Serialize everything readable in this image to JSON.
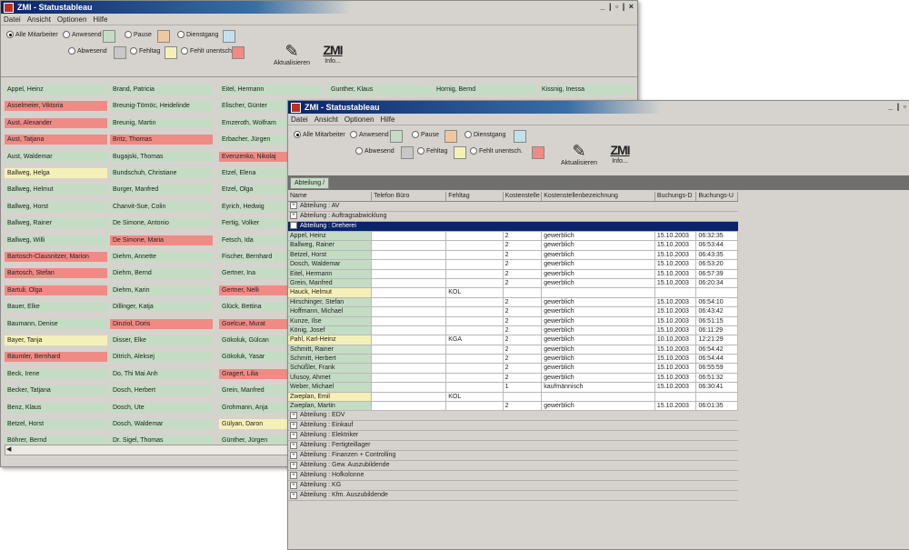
{
  "window1": {
    "title": "ZMI - Statustableau",
    "controls": "_ | ▫ | ×",
    "menu": [
      "Datei",
      "Ansicht",
      "Optionen",
      "Hilfe"
    ],
    "filters": {
      "all": "Alle Mitarbeiter",
      "present": "Anwesend",
      "pause": "Pause",
      "business_trip": "Dienstgang",
      "absent": "Abwesend",
      "absence_day": "Fehltag",
      "unexcused": "Fehlt unentsch."
    },
    "refresh_label": "Aktualisieren",
    "info_label": "Info...",
    "logo_text": "ZMI",
    "columns": [
      [
        {
          "name": "Appel, Heinz",
          "status": "green"
        },
        {
          "name": "Asselmeier, Viktoria",
          "status": "red"
        },
        {
          "name": "Aust, Alexander",
          "status": "red"
        },
        {
          "name": "Aust, Tatjana",
          "status": "red"
        },
        {
          "name": "Aust, Waldemar",
          "status": "green"
        },
        {
          "name": "Ballweg, Helga",
          "status": "yellow"
        },
        {
          "name": "Ballweg, Helmut",
          "status": "green"
        },
        {
          "name": "Ballweg, Horst",
          "status": "green"
        },
        {
          "name": "Ballweg, Rainer",
          "status": "green"
        },
        {
          "name": "Ballweg, Willi",
          "status": "green"
        },
        {
          "name": "Bartosch-Clausnitzer, Marion",
          "status": "red"
        },
        {
          "name": "Bartosch, Stefan",
          "status": "red"
        },
        {
          "name": "Bartuli, Olga",
          "status": "red"
        },
        {
          "name": "Bauer, Elke",
          "status": "green"
        },
        {
          "name": "Baumann, Denise",
          "status": "green"
        },
        {
          "name": "Bayer, Tanja",
          "status": "yellow"
        },
        {
          "name": "Bäumler, Bernhard",
          "status": "red"
        },
        {
          "name": "Beck, Irene",
          "status": "green"
        },
        {
          "name": "Becker, Tatjana",
          "status": "green"
        },
        {
          "name": "Benz, Klaus",
          "status": "green"
        },
        {
          "name": "Betzel, Horst",
          "status": "green"
        },
        {
          "name": "Böhrer, Bernd",
          "status": "green"
        }
      ],
      [
        {
          "name": "Brand, Patricia",
          "status": "green"
        },
        {
          "name": "Breunig-Tömöc, Heidelinde",
          "status": "green"
        },
        {
          "name": "Breunig, Martin",
          "status": "green"
        },
        {
          "name": "Britz, Thomas",
          "status": "red"
        },
        {
          "name": "Bugajski, Thomas",
          "status": "green"
        },
        {
          "name": "Bundschuh, Christiane",
          "status": "green"
        },
        {
          "name": "Burger, Manfred",
          "status": "green"
        },
        {
          "name": "Chanvit-Sue, Colin",
          "status": "green"
        },
        {
          "name": "De Simone, Antonio",
          "status": "green"
        },
        {
          "name": "De Simone, Maria",
          "status": "red"
        },
        {
          "name": "Diehm, Annette",
          "status": "green"
        },
        {
          "name": "Diehm, Bernd",
          "status": "green"
        },
        {
          "name": "Diehm, Karin",
          "status": "green"
        },
        {
          "name": "Dillinger, Katja",
          "status": "green"
        },
        {
          "name": "Dinzioł, Doris",
          "status": "red"
        },
        {
          "name": "Disser, Elke",
          "status": "green"
        },
        {
          "name": "Ditrich, Aleksej",
          "status": "green"
        },
        {
          "name": "Do, Thi Mai Anh",
          "status": "green"
        },
        {
          "name": "Dosch, Herbert",
          "status": "green"
        },
        {
          "name": "Dosch, Ute",
          "status": "green"
        },
        {
          "name": "Dosch, Waldemar",
          "status": "green"
        },
        {
          "name": "Dr. Sigel, Thomas",
          "status": "green"
        }
      ],
      [
        {
          "name": "Eitel, Hermann",
          "status": "green"
        },
        {
          "name": "Elischer, Günter",
          "status": "green"
        },
        {
          "name": "Emzeroth, Wolfram",
          "status": "green"
        },
        {
          "name": "Erbacher, Jürgen",
          "status": "green"
        },
        {
          "name": "Evenzenko, Nikolaj",
          "status": "red"
        },
        {
          "name": "Etzel, Elena",
          "status": "green"
        },
        {
          "name": "Etzel, Olga",
          "status": "green"
        },
        {
          "name": "Eyrich, Hedwig",
          "status": "green"
        },
        {
          "name": "Fertig, Volker",
          "status": "green"
        },
        {
          "name": "Fetsch, Ida",
          "status": "green"
        },
        {
          "name": "Fischer, Bernhard",
          "status": "green"
        },
        {
          "name": "Gertner, Ina",
          "status": "green"
        },
        {
          "name": "Gertner, Nelli",
          "status": "red"
        },
        {
          "name": "Glück, Bettina",
          "status": "green"
        },
        {
          "name": "Goelcue, Murat",
          "status": "red"
        },
        {
          "name": "Gökoluk, Gülcan",
          "status": "green"
        },
        {
          "name": "Gökoluk, Yasar",
          "status": "green"
        },
        {
          "name": "Gragert, Lilia",
          "status": "red"
        },
        {
          "name": "Grein, Manfred",
          "status": "green"
        },
        {
          "name": "Grohmann, Anja",
          "status": "green"
        },
        {
          "name": "Gülyan, Daron",
          "status": "yellow"
        },
        {
          "name": "Günther, Jürgen",
          "status": "green"
        }
      ],
      [
        {
          "name": "Gunther, Klaus",
          "status": "green"
        }
      ],
      [
        {
          "name": "Hornig, Bernd",
          "status": "green"
        }
      ],
      [
        {
          "name": "Kissnig, Inessa",
          "status": "green"
        }
      ]
    ]
  },
  "window2": {
    "title": "ZMI - Statustableau",
    "controls": "_ | ▫",
    "menu": [
      "Datei",
      "Ansicht",
      "Optionen",
      "Hilfe"
    ],
    "filters": {
      "all": "Alle Mitarbeiter",
      "present": "Anwesend",
      "pause": "Pause",
      "business_trip": "Dienstgang",
      "absent": "Abwesend",
      "absence_day": "Fehltag",
      "unexcused": "Fehlt unentsch."
    },
    "refresh_label": "Aktualisieren",
    "info_label": "Info...",
    "logo_text": "ZMI",
    "group_tag": "Abteilung  /",
    "headers": [
      "Name",
      "Telefon Büro",
      "Fehltag",
      "Kostenstelle",
      "Kostenstellenbezeichnung",
      "Buchungs-D",
      "Buchungs-U"
    ],
    "groups_before": [
      "Abteilung : AV",
      "Abteilung : Auftragsabwicklung"
    ],
    "open_group": "Abteilung : Dreherei",
    "rows": [
      {
        "name": "Appel, Heinz",
        "tel": "",
        "fehltag": "",
        "ks": "2",
        "ksb": "gewerblich",
        "date": "15.10.2003",
        "time": "06:32:35",
        "status": "green"
      },
      {
        "name": "Ballweg, Rainer",
        "tel": "",
        "fehltag": "",
        "ks": "2",
        "ksb": "gewerblich",
        "date": "15.10.2003",
        "time": "06:53:44",
        "status": "green"
      },
      {
        "name": "Betzel, Horst",
        "tel": "",
        "fehltag": "",
        "ks": "2",
        "ksb": "gewerblich",
        "date": "15.10.2003",
        "time": "06:43:35",
        "status": "green"
      },
      {
        "name": "Dosch, Waldemar",
        "tel": "",
        "fehltag": "",
        "ks": "2",
        "ksb": "gewerblich",
        "date": "15.10.2003",
        "time": "06:53:20",
        "status": "green"
      },
      {
        "name": "Eitel, Hermann",
        "tel": "",
        "fehltag": "",
        "ks": "2",
        "ksb": "gewerblich",
        "date": "15.10.2003",
        "time": "06:57:39",
        "status": "green"
      },
      {
        "name": "Grein, Manfred",
        "tel": "",
        "fehltag": "",
        "ks": "2",
        "ksb": "gewerblich",
        "date": "15.10.2003",
        "time": "06:20:34",
        "status": "green"
      },
      {
        "name": "Hauck, Helmut",
        "tel": "",
        "fehltag": "KOL",
        "ks": "",
        "ksb": "",
        "date": "",
        "time": "",
        "status": "yellow"
      },
      {
        "name": "Hirschinger, Stefan",
        "tel": "",
        "fehltag": "",
        "ks": "2",
        "ksb": "gewerblich",
        "date": "15.10.2003",
        "time": "06:54:10",
        "status": "green"
      },
      {
        "name": "Hoffmann, Michael",
        "tel": "",
        "fehltag": "",
        "ks": "2",
        "ksb": "gewerblich",
        "date": "15.10.2003",
        "time": "06:43:42",
        "status": "green"
      },
      {
        "name": "Kunze, Ilse",
        "tel": "",
        "fehltag": "",
        "ks": "2",
        "ksb": "gewerblich",
        "date": "15.10.2003",
        "time": "06:51:15",
        "status": "green"
      },
      {
        "name": "König, Josef",
        "tel": "",
        "fehltag": "",
        "ks": "2",
        "ksb": "gewerblich",
        "date": "15.10.2003",
        "time": "06:11:29",
        "status": "green"
      },
      {
        "name": "Pahl, Karl-Heinz",
        "tel": "",
        "fehltag": "KGA",
        "ks": "2",
        "ksb": "gewerblich",
        "date": "10.10.2003",
        "time": "12:21:29",
        "status": "yellow"
      },
      {
        "name": "Schmitt, Rainer",
        "tel": "",
        "fehltag": "",
        "ks": "2",
        "ksb": "gewerblich",
        "date": "15.10.2003",
        "time": "06:54:42",
        "status": "green"
      },
      {
        "name": "Schmitt, Herbert",
        "tel": "",
        "fehltag": "",
        "ks": "2",
        "ksb": "gewerblich",
        "date": "15.10.2003",
        "time": "06:54:44",
        "status": "green"
      },
      {
        "name": "Schüßler, Frank",
        "tel": "",
        "fehltag": "",
        "ks": "2",
        "ksb": "gewerblich",
        "date": "15.10.2003",
        "time": "06:55:59",
        "status": "green"
      },
      {
        "name": "Ulusoy, Ahmet",
        "tel": "",
        "fehltag": "",
        "ks": "2",
        "ksb": "gewerblich",
        "date": "15.10.2003",
        "time": "06:51:32",
        "status": "green"
      },
      {
        "name": "Weber, Michael",
        "tel": "",
        "fehltag": "",
        "ks": "1",
        "ksb": "kaufmännisch",
        "date": "15.10.2003",
        "time": "06:30:41",
        "status": "green"
      },
      {
        "name": "Zweplan, Emil",
        "tel": "",
        "fehltag": "KOL",
        "ks": "",
        "ksb": "",
        "date": "",
        "time": "",
        "status": "yellow"
      },
      {
        "name": "Zweplan, Martin",
        "tel": "",
        "fehltag": "",
        "ks": "2",
        "ksb": "gewerblich",
        "date": "15.10.2003",
        "time": "06:01:35",
        "status": "green"
      }
    ],
    "groups_after": [
      "Abteilung : EDV",
      "Abteilung : Einkauf",
      "Abteilung : Elektriker",
      "Abteilung : Fertigteillager",
      "Abteilung : Finanzen + Controlling",
      "Abteilung : Gew. Auszubildende",
      "Abteilung : Hofkolonne",
      "Abteilung : KG",
      "Abteilung : Kfm. Auszubildende"
    ]
  },
  "colors": {
    "green": "#c4dcc4",
    "red": "#f08a84",
    "yellow": "#f5f0b8",
    "orange": "#f0c8a0",
    "blue": "#c4e0ec",
    "grey": "#c8c8c8",
    "titlebar": "#0a246a"
  }
}
